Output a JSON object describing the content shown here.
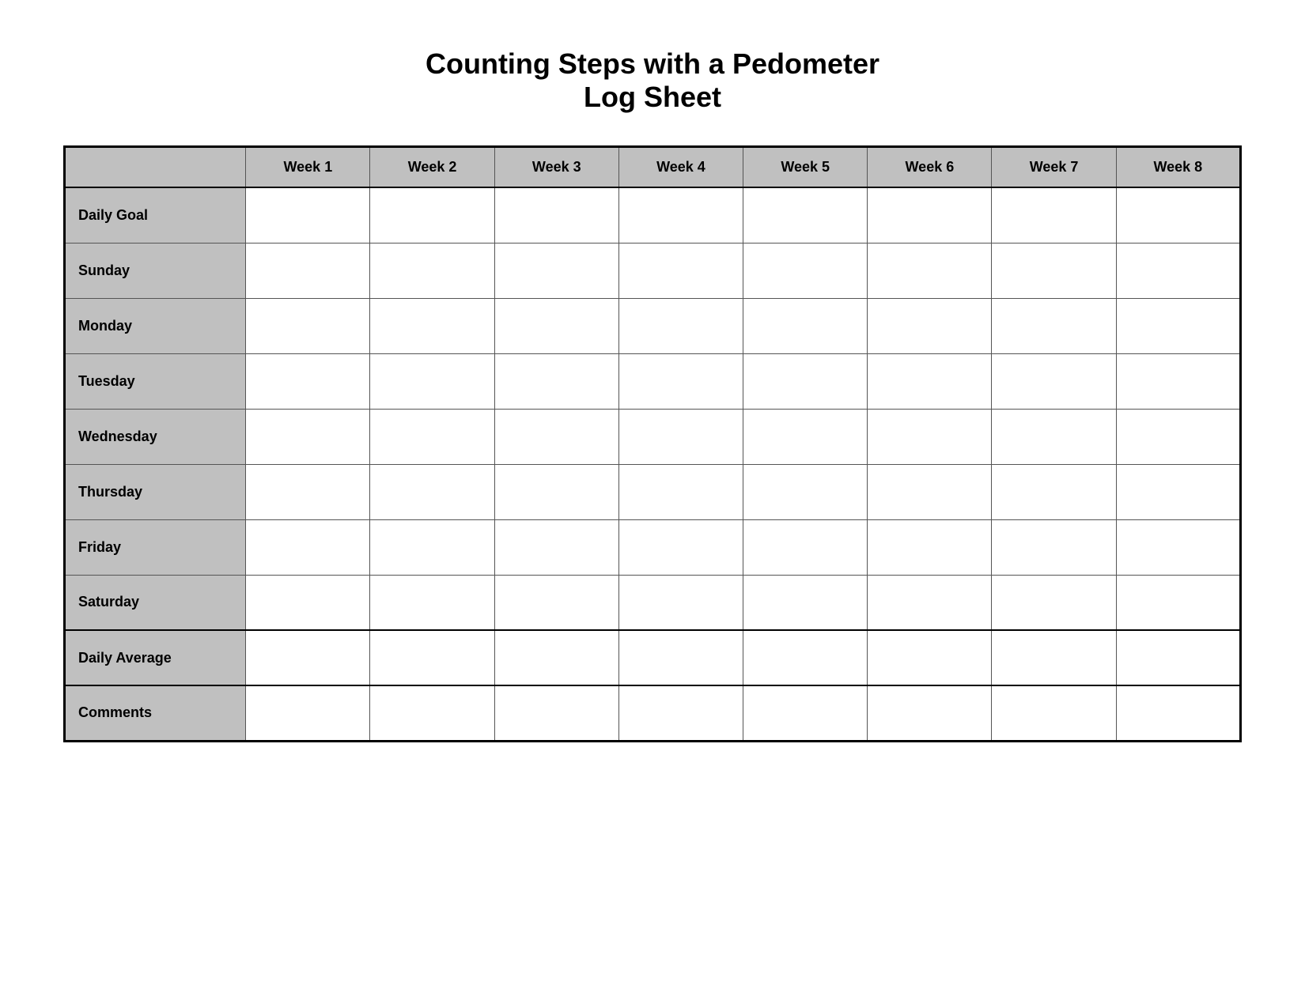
{
  "title": {
    "line1": "Counting Steps with a Pedometer",
    "line2": "Log Sheet"
  },
  "table": {
    "header": {
      "label_col": "",
      "weeks": [
        "Week 1",
        "Week 2",
        "Week 3",
        "Week 4",
        "Week 5",
        "Week 6",
        "Week 7",
        "Week 8"
      ]
    },
    "rows": [
      {
        "label": "Daily Goal"
      },
      {
        "label": "Sunday"
      },
      {
        "label": "Monday"
      },
      {
        "label": "Tuesday"
      },
      {
        "label": "Wednesday"
      },
      {
        "label": "Thursday"
      },
      {
        "label": "Friday"
      },
      {
        "label": "Saturday"
      },
      {
        "label": "Daily Average"
      },
      {
        "label": "Comments"
      }
    ]
  }
}
